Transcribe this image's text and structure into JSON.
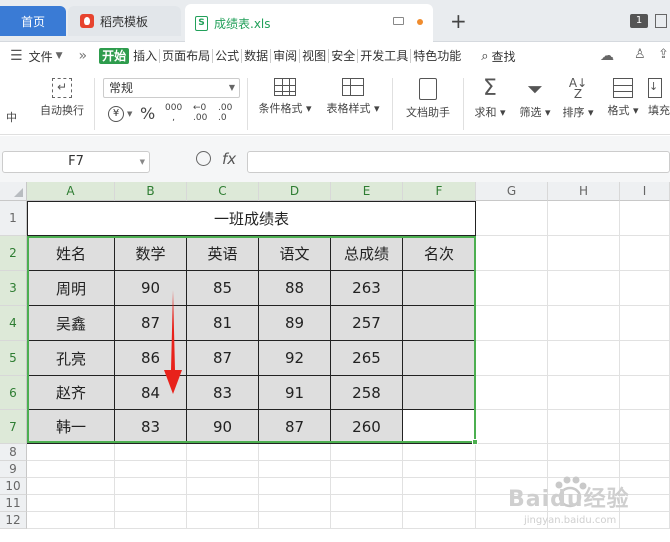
{
  "tabs": {
    "home": "首页",
    "daoke": "稻壳模板",
    "file": "成绩表.xls",
    "add": "+",
    "badge": "1"
  },
  "menu": {
    "file_label": "文件",
    "more": "»",
    "items": [
      "开始",
      "插入",
      "页面布局",
      "公式",
      "数据",
      "审阅",
      "视图",
      "安全",
      "开发工具",
      "特色功能"
    ],
    "search": "查找"
  },
  "toolbar": {
    "wrap_partial": "中",
    "auto_wrap": "自动换行",
    "number_format": "常规",
    "currency": "¥",
    "percent": "%",
    "thousands": "000",
    "dec_add": ".00",
    "dec_sub": ".0",
    "cond_format": "条件格式",
    "table_style": "表格样式",
    "doc_helper": "文档助手",
    "sum": "求和",
    "filter": "筛选",
    "sort": "排序",
    "format": "格式",
    "fill": "填充"
  },
  "formula_bar": {
    "name_box": "F7",
    "fx": "fx",
    "zoom_icon": "search-icon"
  },
  "columns": [
    "A",
    "B",
    "C",
    "D",
    "E",
    "F",
    "G",
    "H",
    "I"
  ],
  "rows": [
    "1",
    "2",
    "3",
    "4",
    "5",
    "6",
    "7",
    "8",
    "9",
    "10",
    "11",
    "12"
  ],
  "sheet": {
    "title": "一班成绩表",
    "headers": [
      "姓名",
      "数学",
      "英语",
      "语文",
      "总成绩",
      "名次"
    ],
    "data": [
      [
        "周明",
        "90",
        "85",
        "88",
        "263",
        ""
      ],
      [
        "吴鑫",
        "87",
        "81",
        "89",
        "257",
        ""
      ],
      [
        "孔亮",
        "86",
        "87",
        "92",
        "265",
        ""
      ],
      [
        "赵齐",
        "84",
        "83",
        "91",
        "258",
        ""
      ],
      [
        "韩一",
        "83",
        "90",
        "87",
        "260",
        ""
      ]
    ]
  },
  "watermark": {
    "text": "Baidu经验",
    "sub": "jingyan.baidu.com"
  },
  "colors": {
    "accent_green": "#2e9c4d",
    "tab_blue": "#3a7bd5",
    "selection": "#4caf50",
    "arrow": "#e8221b",
    "table_fill": "#dedede"
  }
}
